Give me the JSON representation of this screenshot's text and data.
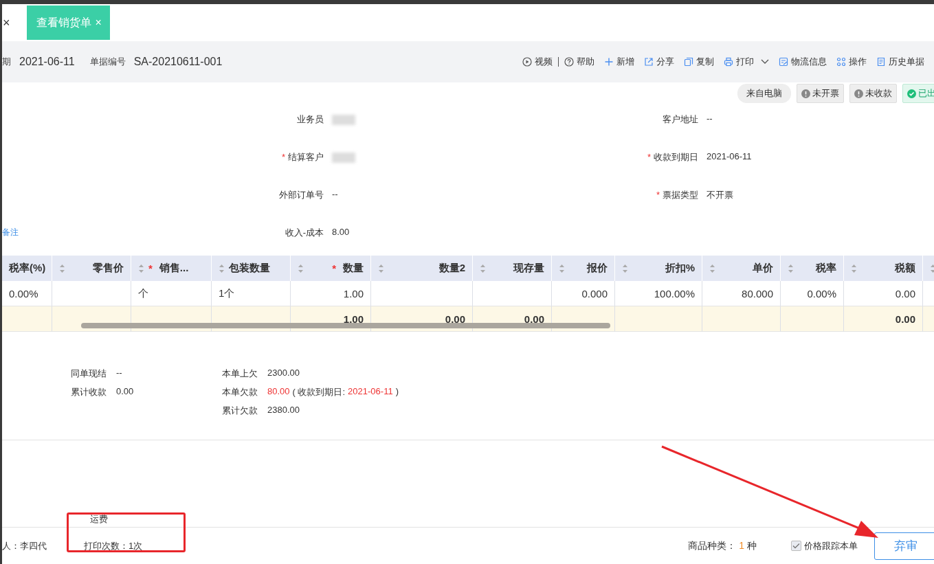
{
  "tab": {
    "label": "查看销货单",
    "close": "×"
  },
  "left_close": "×",
  "header": {
    "fields": [
      {
        "label": "期",
        "value": "2021-06-11"
      },
      {
        "label": "单据编号",
        "value": "SA-20210611-001"
      }
    ],
    "actions": [
      {
        "label": "视频",
        "divider_after": true
      },
      {
        "label": "帮助"
      },
      {
        "label": "新增"
      },
      {
        "label": "分享"
      },
      {
        "label": "复制"
      },
      {
        "label": "打印",
        "dropdown": true
      },
      {
        "label": "物流信息"
      },
      {
        "label": "操作"
      },
      {
        "label": "历史单据"
      }
    ]
  },
  "status_tags": [
    {
      "kind": "source",
      "label": "来自电脑"
    },
    {
      "kind": "pending",
      "label": "未开票"
    },
    {
      "kind": "pending",
      "label": "未收款"
    },
    {
      "kind": "done",
      "label": "已出"
    }
  ],
  "form": {
    "link": "备注",
    "rows": [
      [
        {
          "label": "业务员",
          "blurred": true
        },
        {
          "label": "客户地址",
          "value": "--"
        }
      ],
      [
        {
          "asterisk": "*",
          "label": "结算客户",
          "blurred": true
        },
        {
          "asterisk": "*",
          "label": "收款到期日",
          "value": "2021-06-11"
        }
      ],
      [
        {
          "label": "外部订单号",
          "value": "--"
        },
        {
          "asterisk": "*",
          "label": "票据类型",
          "value": "不开票"
        }
      ],
      [
        {
          "label": "收入-成本",
          "value": "8.00"
        }
      ]
    ]
  },
  "table": {
    "columns": [
      {
        "label": "税率(%)"
      },
      {
        "label": "零售价"
      },
      {
        "asterisk": "*",
        "label": "销售..."
      },
      {
        "label": "包装数量"
      },
      {
        "asterisk": "*",
        "label": "数量"
      },
      {
        "label": "数量2"
      },
      {
        "label": "现存量"
      },
      {
        "label": "报价"
      },
      {
        "label": "折扣%"
      },
      {
        "label": "单价"
      },
      {
        "label": "税率"
      },
      {
        "label": "税额"
      }
    ],
    "rows": [
      {
        "tax_rate_pct": "0.00%",
        "sales_unit": "个",
        "pack_qty": "1个",
        "qty": "1.00",
        "quote": "0.000",
        "discount": "100.00%",
        "unit_price": "80.000",
        "tax_rate": "0.00%",
        "tax": "0.00"
      }
    ],
    "totals": {
      "qty": "1.00",
      "qty2": "0.00",
      "stock": "0.00",
      "tax": "0.00"
    }
  },
  "summary": {
    "left": [
      {
        "label": "同单现结",
        "value": "--"
      },
      {
        "label": "累计收款",
        "value": "0.00"
      }
    ],
    "right": [
      {
        "label": "本单上欠",
        "parts": [
          {
            "text": "2300.00",
            "highlight": false
          }
        ]
      },
      {
        "label": "本单欠款",
        "parts": [
          {
            "text": "80.00",
            "highlight": true
          },
          {
            "text": "( 收款到期日:",
            "highlight": false
          },
          {
            "text": "2021-06-11",
            "highlight": true
          },
          {
            "text": ")",
            "highlight": false
          }
        ]
      },
      {
        "label": "累计欠款",
        "parts": [
          {
            "text": "2380.00",
            "highlight": false
          }
        ]
      }
    ]
  },
  "freight_label": "运费",
  "footer": {
    "maker": "人：李四代",
    "print_count": "打印次数：1次",
    "kinds_label": "商品种类：",
    "kinds_count": "1",
    "kinds_unit": "种",
    "track": {
      "label": "价格跟踪本单",
      "checked": true
    },
    "button": "弃审"
  }
}
